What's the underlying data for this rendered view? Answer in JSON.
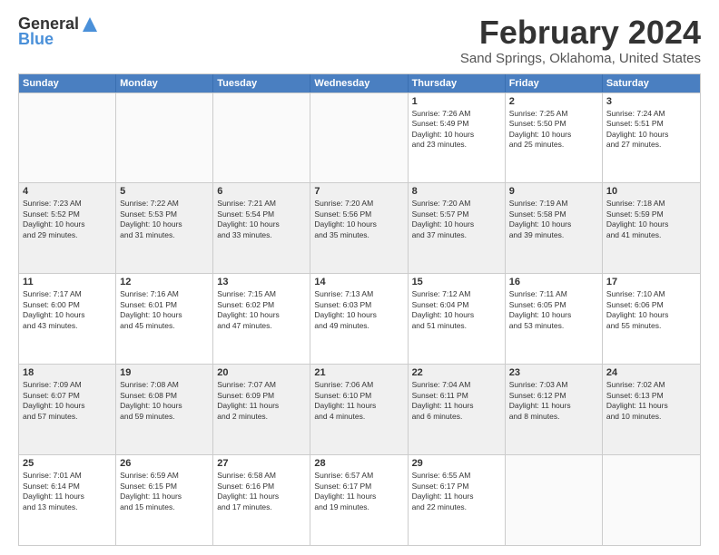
{
  "logo": {
    "general": "General",
    "blue": "Blue"
  },
  "title": "February 2024",
  "subtitle": "Sand Springs, Oklahoma, United States",
  "weekdays": [
    "Sunday",
    "Monday",
    "Tuesday",
    "Wednesday",
    "Thursday",
    "Friday",
    "Saturday"
  ],
  "rows": [
    {
      "shaded": false,
      "cells": [
        {
          "day": "",
          "empty": true,
          "info": ""
        },
        {
          "day": "",
          "empty": true,
          "info": ""
        },
        {
          "day": "",
          "empty": true,
          "info": ""
        },
        {
          "day": "",
          "empty": true,
          "info": ""
        },
        {
          "day": "1",
          "empty": false,
          "info": "Sunrise: 7:26 AM\nSunset: 5:49 PM\nDaylight: 10 hours\nand 23 minutes."
        },
        {
          "day": "2",
          "empty": false,
          "info": "Sunrise: 7:25 AM\nSunset: 5:50 PM\nDaylight: 10 hours\nand 25 minutes."
        },
        {
          "day": "3",
          "empty": false,
          "info": "Sunrise: 7:24 AM\nSunset: 5:51 PM\nDaylight: 10 hours\nand 27 minutes."
        }
      ]
    },
    {
      "shaded": true,
      "cells": [
        {
          "day": "4",
          "empty": false,
          "info": "Sunrise: 7:23 AM\nSunset: 5:52 PM\nDaylight: 10 hours\nand 29 minutes."
        },
        {
          "day": "5",
          "empty": false,
          "info": "Sunrise: 7:22 AM\nSunset: 5:53 PM\nDaylight: 10 hours\nand 31 minutes."
        },
        {
          "day": "6",
          "empty": false,
          "info": "Sunrise: 7:21 AM\nSunset: 5:54 PM\nDaylight: 10 hours\nand 33 minutes."
        },
        {
          "day": "7",
          "empty": false,
          "info": "Sunrise: 7:20 AM\nSunset: 5:56 PM\nDaylight: 10 hours\nand 35 minutes."
        },
        {
          "day": "8",
          "empty": false,
          "info": "Sunrise: 7:20 AM\nSunset: 5:57 PM\nDaylight: 10 hours\nand 37 minutes."
        },
        {
          "day": "9",
          "empty": false,
          "info": "Sunrise: 7:19 AM\nSunset: 5:58 PM\nDaylight: 10 hours\nand 39 minutes."
        },
        {
          "day": "10",
          "empty": false,
          "info": "Sunrise: 7:18 AM\nSunset: 5:59 PM\nDaylight: 10 hours\nand 41 minutes."
        }
      ]
    },
    {
      "shaded": false,
      "cells": [
        {
          "day": "11",
          "empty": false,
          "info": "Sunrise: 7:17 AM\nSunset: 6:00 PM\nDaylight: 10 hours\nand 43 minutes."
        },
        {
          "day": "12",
          "empty": false,
          "info": "Sunrise: 7:16 AM\nSunset: 6:01 PM\nDaylight: 10 hours\nand 45 minutes."
        },
        {
          "day": "13",
          "empty": false,
          "info": "Sunrise: 7:15 AM\nSunset: 6:02 PM\nDaylight: 10 hours\nand 47 minutes."
        },
        {
          "day": "14",
          "empty": false,
          "info": "Sunrise: 7:13 AM\nSunset: 6:03 PM\nDaylight: 10 hours\nand 49 minutes."
        },
        {
          "day": "15",
          "empty": false,
          "info": "Sunrise: 7:12 AM\nSunset: 6:04 PM\nDaylight: 10 hours\nand 51 minutes."
        },
        {
          "day": "16",
          "empty": false,
          "info": "Sunrise: 7:11 AM\nSunset: 6:05 PM\nDaylight: 10 hours\nand 53 minutes."
        },
        {
          "day": "17",
          "empty": false,
          "info": "Sunrise: 7:10 AM\nSunset: 6:06 PM\nDaylight: 10 hours\nand 55 minutes."
        }
      ]
    },
    {
      "shaded": true,
      "cells": [
        {
          "day": "18",
          "empty": false,
          "info": "Sunrise: 7:09 AM\nSunset: 6:07 PM\nDaylight: 10 hours\nand 57 minutes."
        },
        {
          "day": "19",
          "empty": false,
          "info": "Sunrise: 7:08 AM\nSunset: 6:08 PM\nDaylight: 10 hours\nand 59 minutes."
        },
        {
          "day": "20",
          "empty": false,
          "info": "Sunrise: 7:07 AM\nSunset: 6:09 PM\nDaylight: 11 hours\nand 2 minutes."
        },
        {
          "day": "21",
          "empty": false,
          "info": "Sunrise: 7:06 AM\nSunset: 6:10 PM\nDaylight: 11 hours\nand 4 minutes."
        },
        {
          "day": "22",
          "empty": false,
          "info": "Sunrise: 7:04 AM\nSunset: 6:11 PM\nDaylight: 11 hours\nand 6 minutes."
        },
        {
          "day": "23",
          "empty": false,
          "info": "Sunrise: 7:03 AM\nSunset: 6:12 PM\nDaylight: 11 hours\nand 8 minutes."
        },
        {
          "day": "24",
          "empty": false,
          "info": "Sunrise: 7:02 AM\nSunset: 6:13 PM\nDaylight: 11 hours\nand 10 minutes."
        }
      ]
    },
    {
      "shaded": false,
      "cells": [
        {
          "day": "25",
          "empty": false,
          "info": "Sunrise: 7:01 AM\nSunset: 6:14 PM\nDaylight: 11 hours\nand 13 minutes."
        },
        {
          "day": "26",
          "empty": false,
          "info": "Sunrise: 6:59 AM\nSunset: 6:15 PM\nDaylight: 11 hours\nand 15 minutes."
        },
        {
          "day": "27",
          "empty": false,
          "info": "Sunrise: 6:58 AM\nSunset: 6:16 PM\nDaylight: 11 hours\nand 17 minutes."
        },
        {
          "day": "28",
          "empty": false,
          "info": "Sunrise: 6:57 AM\nSunset: 6:17 PM\nDaylight: 11 hours\nand 19 minutes."
        },
        {
          "day": "29",
          "empty": false,
          "info": "Sunrise: 6:55 AM\nSunset: 6:17 PM\nDaylight: 11 hours\nand 22 minutes."
        },
        {
          "day": "",
          "empty": true,
          "info": ""
        },
        {
          "day": "",
          "empty": true,
          "info": ""
        }
      ]
    }
  ]
}
